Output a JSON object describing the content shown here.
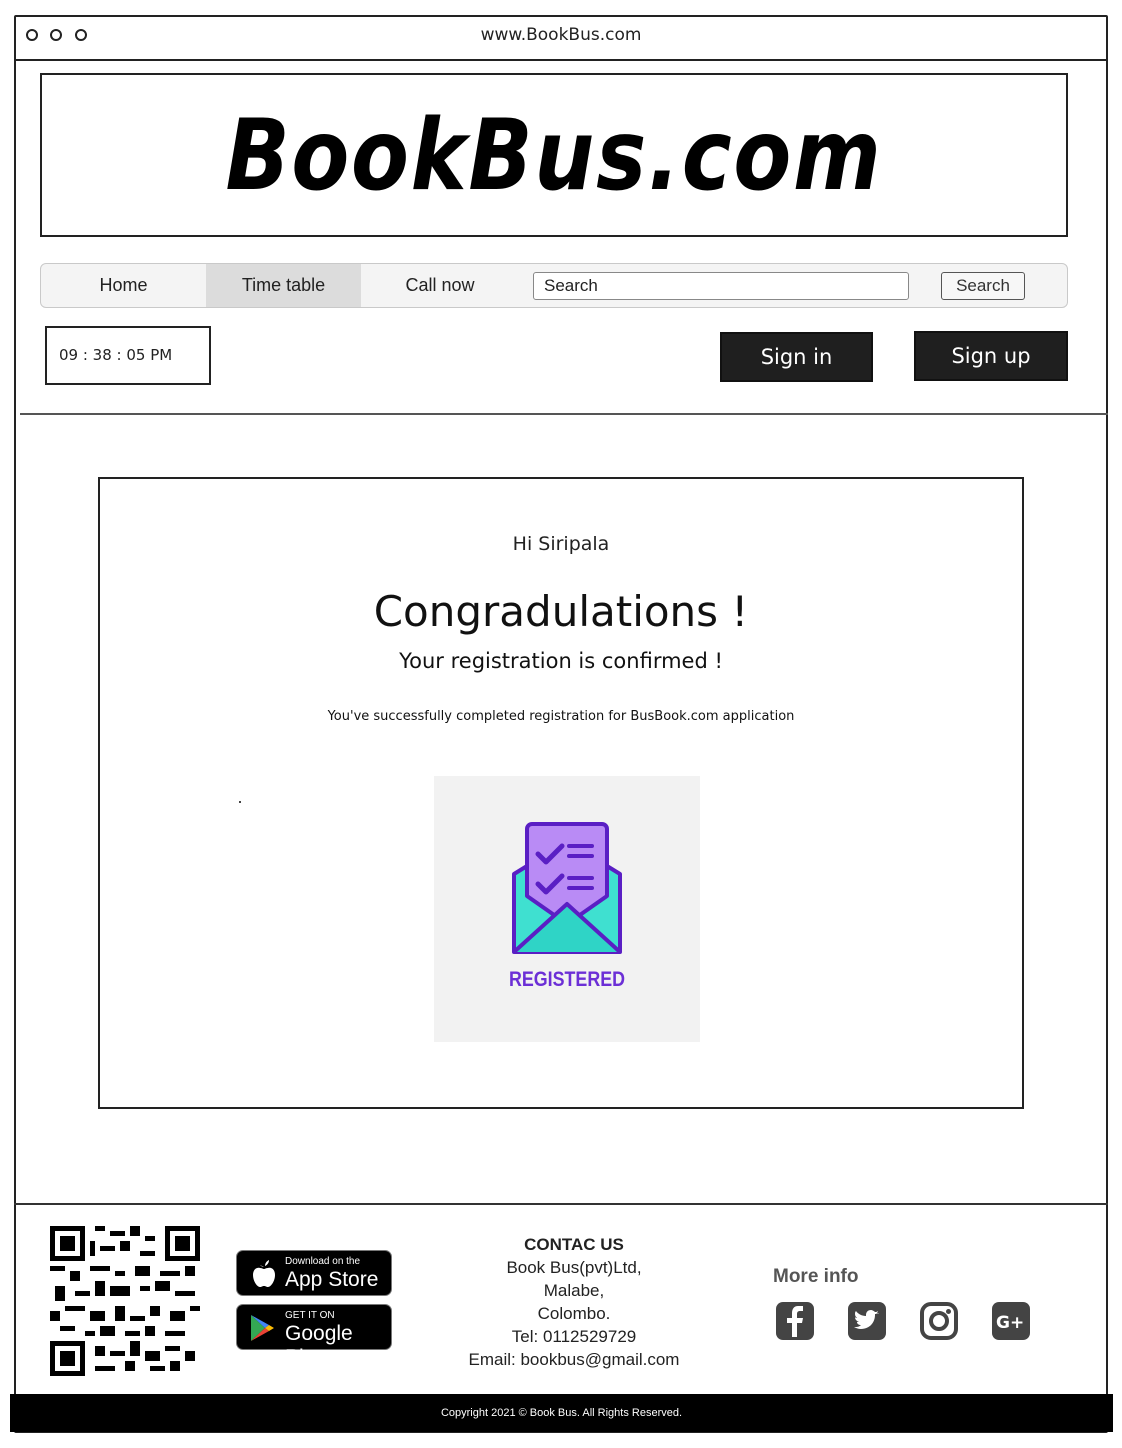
{
  "browser": {
    "url": "www.BookBus.com"
  },
  "header": {
    "logo_text": "BookBus.com"
  },
  "nav": {
    "items": [
      {
        "label": "Home"
      },
      {
        "label": "Time table"
      },
      {
        "label": "Call now"
      }
    ],
    "active": "Time table",
    "search_value": "Search",
    "search_button": "Search"
  },
  "toolbar": {
    "clock": "09 : 38 : 05 PM",
    "sign_in": "Sign in",
    "sign_up": "Sign up"
  },
  "confirmation": {
    "greeting": "Hi Siripala",
    "headline": "Congradulations !",
    "subheadline": "Your registration is confirmed !",
    "message": "You've successfully completed registration for BusBook.com application",
    "image_label": "REGISTERED"
  },
  "footer": {
    "app_store": {
      "small": "Download on the",
      "big": "App Store"
    },
    "google_play": {
      "small": "GET IT ON",
      "big": "Google Play"
    },
    "contact": {
      "title": "CONTAC US",
      "lines": [
        "Book Bus(pvt)Ltd,",
        "Malabe,",
        "Colombo.",
        "Tel: 0112529729",
        "Email: bookbus@gmail.com"
      ]
    },
    "more_info": "More info",
    "social_icons": [
      "facebook-icon",
      "twitter-icon",
      "instagram-icon",
      "google-plus-icon"
    ],
    "copyright": "Copyright 2021 © Book Bus. All Rights Reserved."
  },
  "colors": {
    "dark_button": "#1f1f1f",
    "registered_purple": "#6c2fd6",
    "nav_active_bg": "#dcdcdc"
  }
}
